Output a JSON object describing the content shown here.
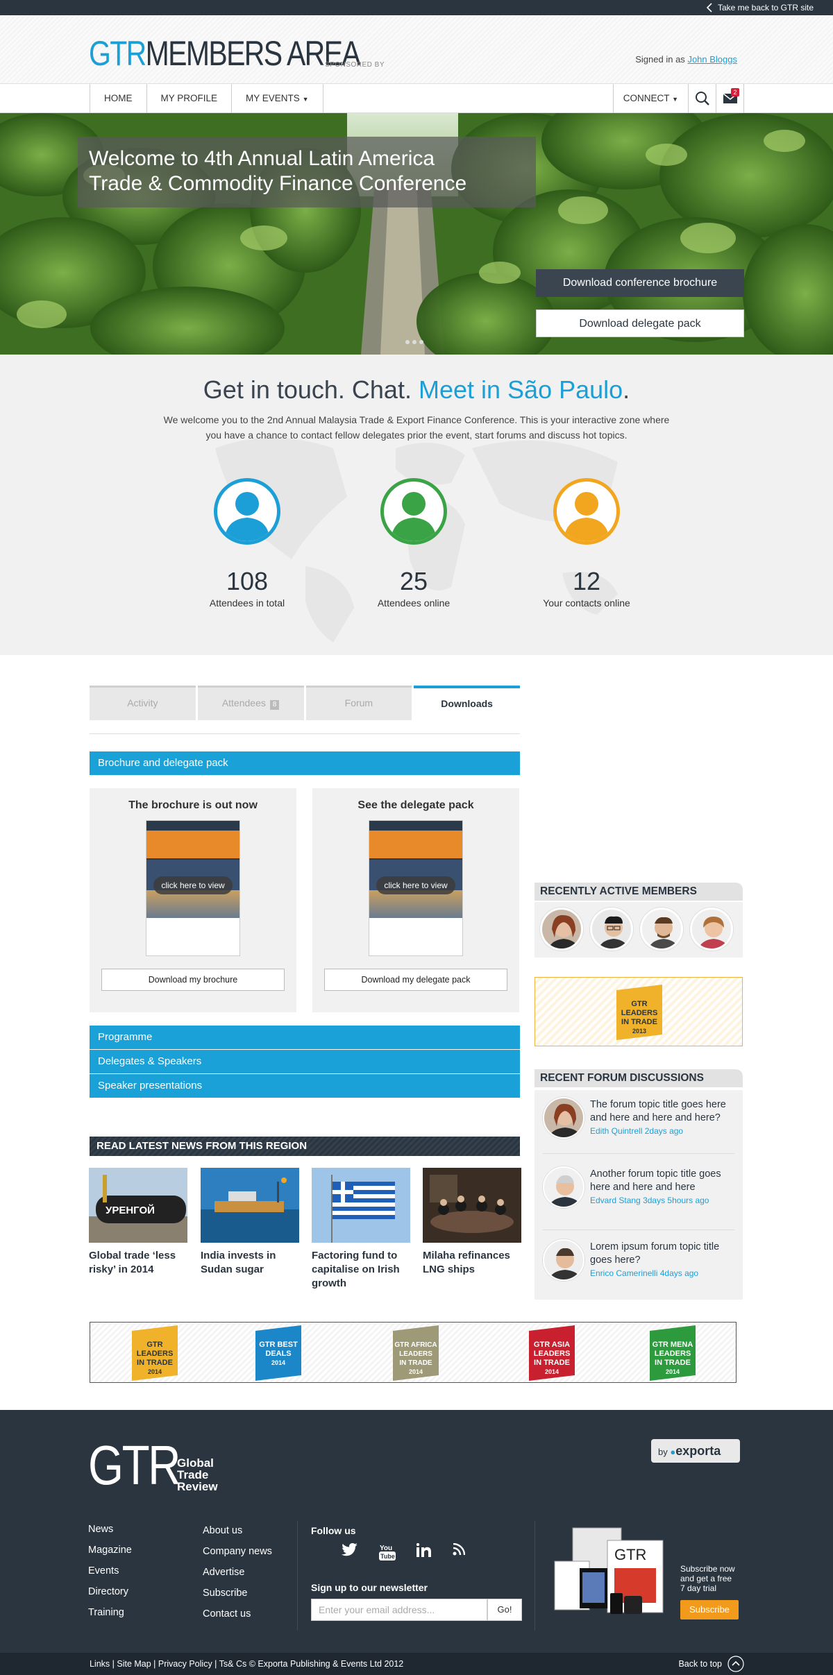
{
  "topbar": {
    "back_label": "Take me back to GTR site"
  },
  "header": {
    "logo_gtr": "GTR",
    "logo_members": "MEMBERS AREA",
    "sponsored": "SPONSORED BY",
    "signed_in_prefix": "Signed in as",
    "user_name": "John Bloggs"
  },
  "nav": {
    "items": [
      "HOME",
      "MY PROFILE",
      "MY EVENTS"
    ],
    "connect": "CONNECT",
    "mail_count": "2"
  },
  "hero": {
    "title_line1": "Welcome to 4th Annual Latin America",
    "title_line2": "Trade & Commodity Finance Conference",
    "btn_brochure": "Download conference brochure",
    "btn_delegate": "Download delegate pack"
  },
  "touch": {
    "heading_part1": "Get in touch. Chat.",
    "heading_highlight": "Meet in São Paulo",
    "heading_end": ".",
    "intro": "We welcome you to the 2nd Annual Malaysia Trade & Export Finance Conference. This is your interactive zone where you have a chance to contact fellow delegates prior the event, start forums and discuss hot topics.",
    "stats": [
      {
        "num": "108",
        "label": "Attendees in total",
        "color": "#1b9fd6"
      },
      {
        "num": "25",
        "label": "Attendees online",
        "color": "#3aa346"
      },
      {
        "num": "12",
        "label": "Your contacts online",
        "color": "#f2a51f"
      }
    ]
  },
  "tabs": {
    "activity": "Activity",
    "attendees": "Attendees",
    "attendees_badge": "8",
    "forum": "Forum",
    "downloads": "Downloads"
  },
  "downloads": {
    "section_title": "Brochure and delegate pack",
    "card1_title": "The brochure is out now",
    "card1_view": "click here to view",
    "card1_btn": "Download my brochure",
    "card2_title": "See the delegate pack",
    "card2_view": "click here to view",
    "card2_btn": "Download my delegate pack",
    "accordion": [
      "Programme",
      "Delegates & Speakers",
      "Speaker presentations"
    ]
  },
  "news": {
    "heading": "READ LATEST NEWS FROM THIS REGION",
    "items": [
      {
        "title": "Global trade ‘less risky’ in 2014"
      },
      {
        "title": "India invests in Sudan sugar"
      },
      {
        "title": "Factoring fund to capitalise on Irish growth"
      },
      {
        "title": "Milaha refinances LNG ships"
      }
    ]
  },
  "sidebar": {
    "members_heading": "RECENTLY ACTIVE MEMBERS",
    "leaders_badge": {
      "line1": "GTR",
      "line2": "LEADERS",
      "line3": "IN TRADE",
      "year": "2013"
    },
    "forum_heading": "RECENT FORUM DISCUSSIONS",
    "forum_items": [
      {
        "title": "The forum topic title goes here and here and here and here?",
        "author": "Edith Quintrell",
        "time": "2days ago"
      },
      {
        "title": "Another forum topic title goes here and here and here",
        "author": "Edvard Stang",
        "time": "3days 5hours ago"
      },
      {
        "title": "Lorem ipsum forum topic title goes here?",
        "author": "Enrico Camerinelli",
        "time": "4days ago"
      }
    ]
  },
  "logos": [
    {
      "l1": "GTR",
      "l2": "LEADERS",
      "l3": "IN TRADE",
      "year": "2014",
      "color": "#f0b22a"
    },
    {
      "l1": "GTR BEST",
      "l2": "DEALS",
      "l3": "",
      "year": "2014",
      "color": "#1b86c8"
    },
    {
      "l1": "GTR AFRICA",
      "l2": "LEADERS",
      "l3": "IN TRADE",
      "year": "2014",
      "color": "#9e9a78"
    },
    {
      "l1": "GTR ASIA",
      "l2": "LEADERS",
      "l3": "IN TRADE",
      "year": "2014",
      "color": "#c8202e"
    },
    {
      "l1": "GTR MENA",
      "l2": "LEADERS",
      "l3": "IN TRADE",
      "year": "2014",
      "color": "#2e9a3e"
    }
  ],
  "footer": {
    "logo": "GTR",
    "logo_sub1": "Global",
    "logo_sub2": "Trade",
    "logo_sub3": "Review",
    "by": "by",
    "exporta": "exporta",
    "col1": [
      "News",
      "Magazine",
      "Events",
      "Directory",
      "Training"
    ],
    "col2": [
      "About us",
      "Company news",
      "Advertise",
      "Subscribe",
      "Contact us"
    ],
    "follow": "Follow us",
    "newsletter": "Sign up to our newsletter",
    "email_placeholder": "Enter your email address...",
    "go": "Go!",
    "subscribe_text1": "Subscribe now",
    "subscribe_text2": "and get  a free",
    "subscribe_text3": "7 day trial",
    "subscribe_btn": "Subscribe",
    "bottom_links": "Links | Site Map | Privacy Policy | Ts& Cs  © Exporta Publishing & Events Ltd 2012",
    "back_to_top": "Back to top"
  }
}
